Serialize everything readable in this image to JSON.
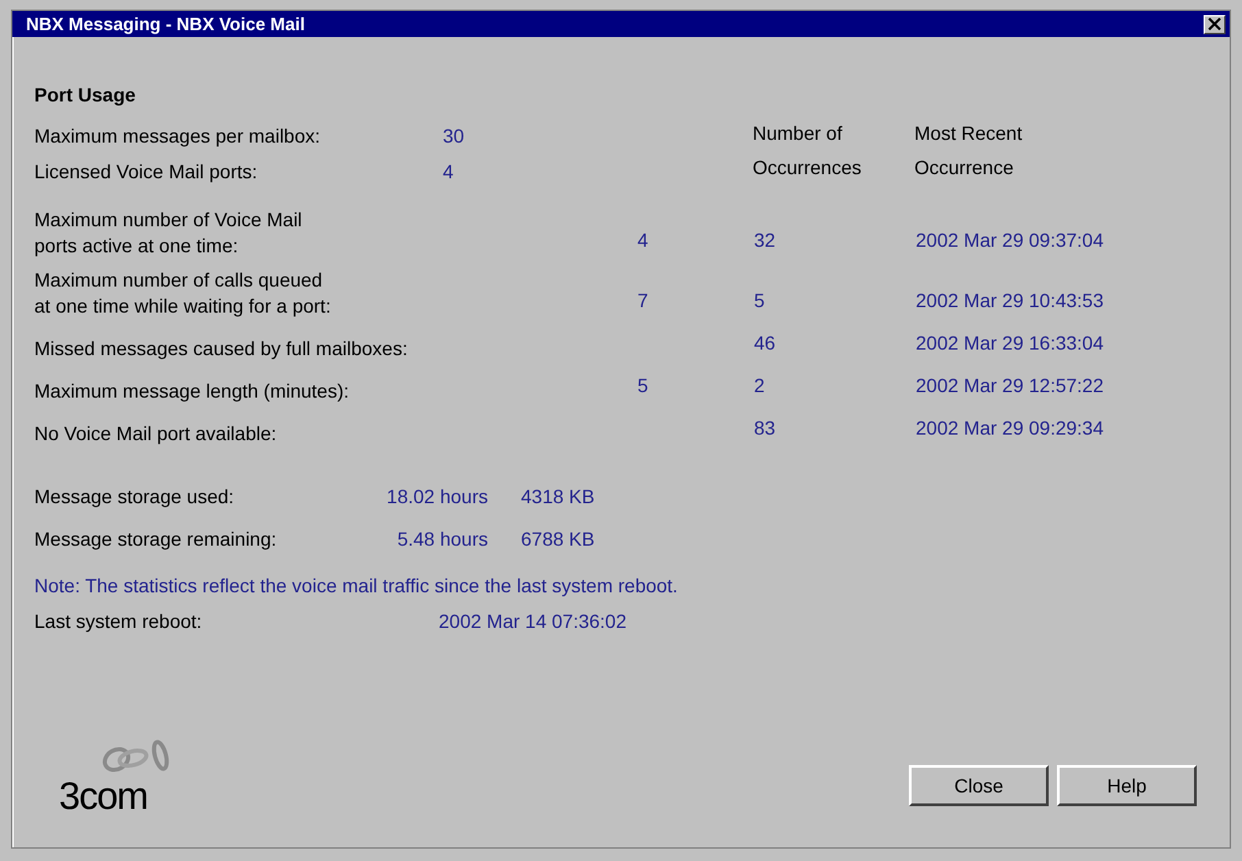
{
  "window": {
    "title": "NBX Messaging - NBX Voice Mail"
  },
  "section_title": "Port Usage",
  "settings": [
    {
      "label": "Maximum messages per mailbox:",
      "value": "30"
    },
    {
      "label": "Licensed Voice Mail ports:",
      "value": "4"
    }
  ],
  "columns": [
    "Number of Occurrences",
    "Most Recent Occurrence"
  ],
  "stats": [
    {
      "label": [
        "Maximum number of Voice Mail",
        "ports active at one time:"
      ],
      "maximum": "4",
      "occurrences": "32",
      "most_recent": "2002 Mar 29 09:37:04"
    },
    {
      "label": [
        "Maximum number of calls queued",
        "at one time while waiting for a port:"
      ],
      "maximum": "7",
      "occurrences": "5",
      "most_recent": "2002 Mar 29 10:43:53"
    },
    {
      "label": [
        "Missed messages caused by full mailboxes:"
      ],
      "occurrences": "46",
      "most_recent": "2002 Mar 29 16:33:04"
    },
    {
      "label": [
        "Maximum message length (minutes):"
      ],
      "maximum": "5",
      "occurrences": "2",
      "most_recent": "2002 Mar 29 12:57:22"
    },
    {
      "label": [
        "No Voice Mail port available:"
      ],
      "occurrences": "83",
      "most_recent": "2002 Mar 29 09:29:34"
    }
  ],
  "storage": [
    {
      "label": "Message storage used:",
      "hours": "18.02 hours",
      "size": "4318 KB"
    },
    {
      "label": "Message storage remaining:",
      "hours": "5.48 hours",
      "size": "6788 KB"
    }
  ],
  "note": "Note: The statistics reflect the voice mail traffic since the last system reboot.",
  "reboot": {
    "label": "Last system reboot:",
    "value": "2002 Mar 14 07:36:02"
  },
  "logo": {
    "text": "3com"
  },
  "buttons": [
    "Close",
    "Help"
  ]
}
